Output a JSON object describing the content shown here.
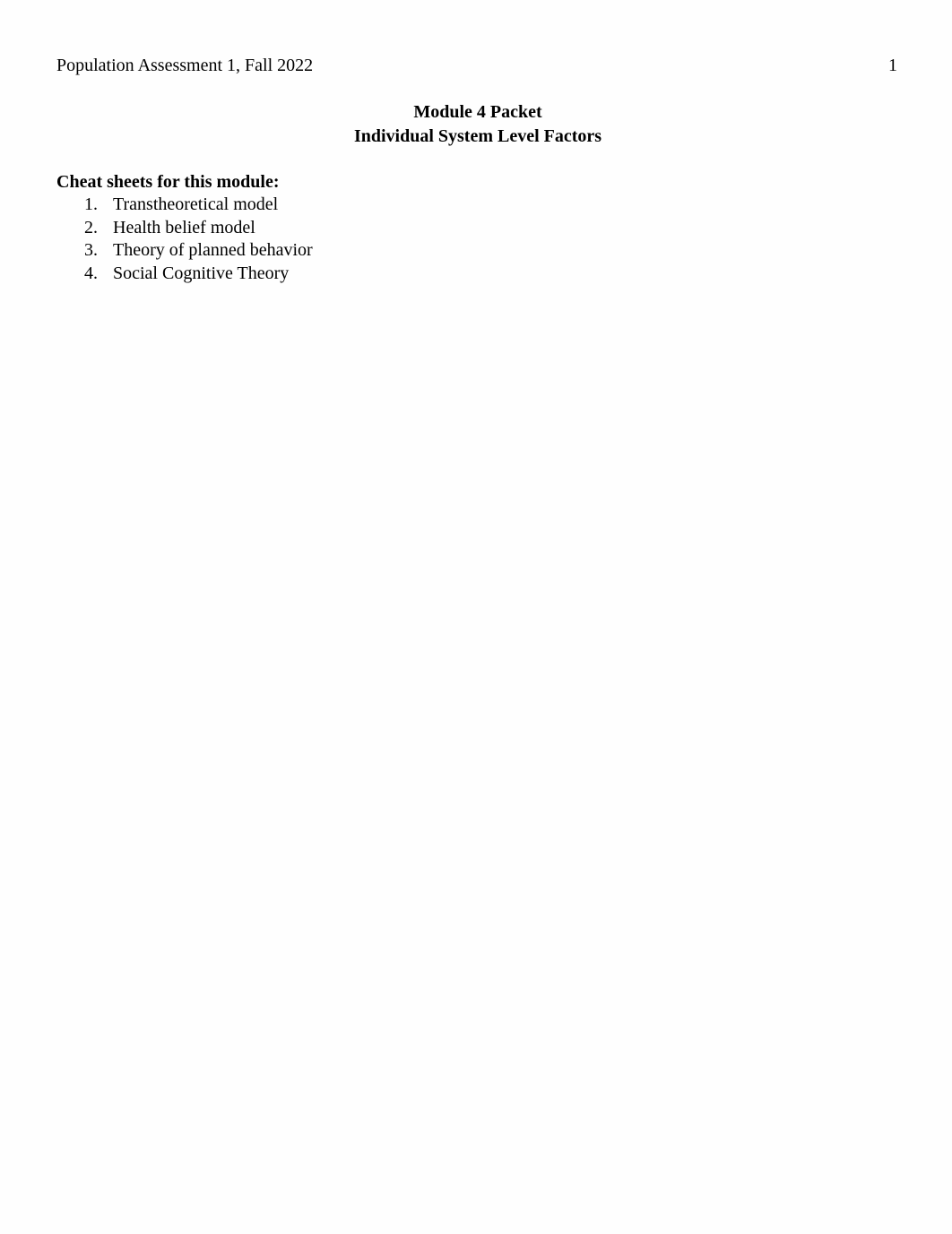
{
  "header": {
    "running_head": "Population Assessment 1, Fall 2022",
    "page_number": "1"
  },
  "title": {
    "line1": "Module 4 Packet",
    "line2": "Individual System Level Factors"
  },
  "cheat_sheets": {
    "heading": "Cheat sheets for this module:",
    "items": [
      {
        "number": "1.",
        "label": "Transtheoretical model"
      },
      {
        "number": "2.",
        "label": "Health belief model"
      },
      {
        "number": "3.",
        "label": "Theory of planned behavior"
      },
      {
        "number": "4.",
        "label": "Social Cognitive Theory"
      }
    ]
  }
}
